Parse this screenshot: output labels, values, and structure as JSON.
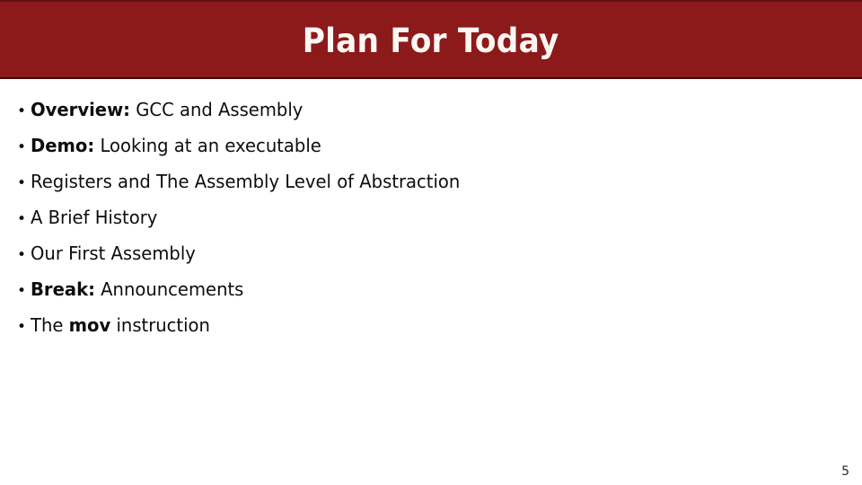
{
  "slide": {
    "title": "Plan For Today",
    "page_number": "5",
    "bullet_marker": "•",
    "colors": {
      "banner_background": "#8C1A1A",
      "banner_border_top": "#5E1111",
      "banner_border_bottom": "#3D0C0C",
      "title_text": "#FDF7F4",
      "body_background": "#FFFFFF",
      "body_text": "#0D0D0D",
      "page_number_text": "#2B2B2B"
    },
    "bullets": [
      {
        "bold_lead": "Overview:",
        "rest": " GCC and Assembly",
        "full_text": "Overview: GCC and Assembly"
      },
      {
        "bold_lead": "Demo:",
        "rest": " Looking at an executable",
        "full_text": "Demo: Looking at an executable"
      },
      {
        "bold_lead": "",
        "rest": "Registers and The Assembly Level of Abstraction",
        "full_text": "Registers and The Assembly Level of Abstraction"
      },
      {
        "bold_lead": "",
        "rest": "A Brief History",
        "full_text": "A Brief History"
      },
      {
        "bold_lead": "",
        "rest": "Our First Assembly",
        "full_text": "Our First Assembly"
      },
      {
        "bold_lead": "Break:",
        "rest": " Announcements",
        "full_text": "Break: Announcements"
      },
      {
        "bold_lead": "",
        "rest": "The ",
        "bold_mid": "mov",
        "rest2": " instruction",
        "full_text": "The mov instruction"
      }
    ]
  }
}
